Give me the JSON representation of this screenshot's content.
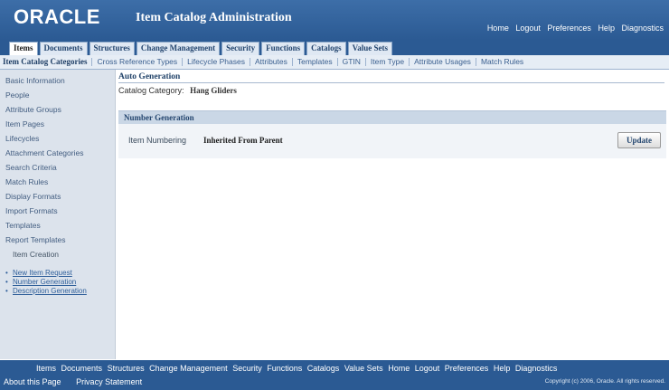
{
  "header": {
    "logo": "ORACLE",
    "app_title": "Item Catalog Administration",
    "global_links": [
      "Home",
      "Logout",
      "Preferences",
      "Help",
      "Diagnostics"
    ]
  },
  "tabs": [
    {
      "label": "Items",
      "active": true
    },
    {
      "label": "Documents"
    },
    {
      "label": "Structures"
    },
    {
      "label": "Change Management"
    },
    {
      "label": "Security"
    },
    {
      "label": "Functions"
    },
    {
      "label": "Catalogs"
    },
    {
      "label": "Value Sets"
    }
  ],
  "subtabs": [
    {
      "label": "Item Catalog Categories",
      "active": true
    },
    {
      "label": "Cross Reference Types"
    },
    {
      "label": "Lifecycle Phases"
    },
    {
      "label": "Attributes"
    },
    {
      "label": "Templates"
    },
    {
      "label": "GTIN"
    },
    {
      "label": "Item Type"
    },
    {
      "label": "Attribute Usages"
    },
    {
      "label": "Match Rules"
    }
  ],
  "sidebar": {
    "items": [
      "Basic Information",
      "People",
      "Attribute Groups",
      "Item Pages",
      "Lifecycles",
      "Attachment Categories",
      "Search Criteria",
      "Match Rules",
      "Display Formats",
      "Import Formats",
      "Templates",
      "Report Templates"
    ],
    "current": "Item Creation",
    "links": [
      "New Item Request",
      "Number Generation",
      "Description Generation"
    ]
  },
  "main": {
    "page_title": "Auto Generation",
    "catalog_category_label": "Catalog Category:",
    "catalog_category_value": "Hang Gliders",
    "section_title": "Number Generation",
    "item_numbering_label": "Item Numbering",
    "item_numbering_value": "Inherited From Parent",
    "update_button": "Update"
  },
  "footer": {
    "links": [
      "Items",
      "Documents",
      "Structures",
      "Change Management",
      "Security",
      "Functions",
      "Catalogs",
      "Value Sets",
      "Home",
      "Logout",
      "Preferences",
      "Help",
      "Diagnostics"
    ],
    "about": "About this Page",
    "privacy": "Privacy Statement",
    "copyright": "Copyright (c) 2006, Oracle. All rights reserved."
  }
}
